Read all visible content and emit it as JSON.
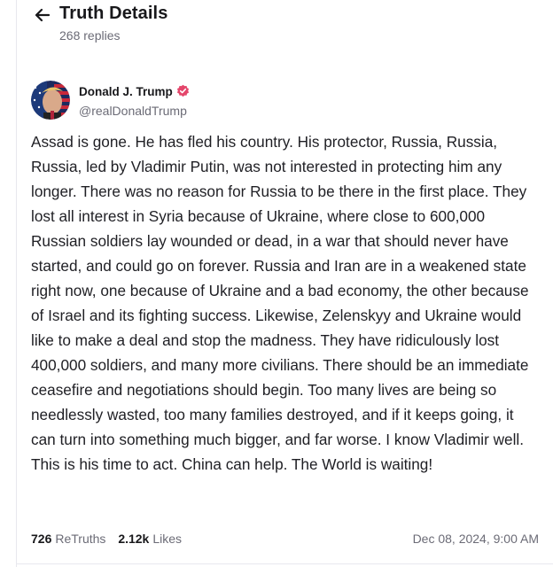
{
  "header": {
    "title": "Truth Details",
    "replies": "268 replies",
    "back_icon": "arrow-left-icon"
  },
  "post": {
    "author": {
      "name": "Donald J. Trump",
      "handle": "@realDonaldTrump",
      "verified_icon": "verified-badge-icon",
      "verified_color": "#e4466b"
    },
    "text": "Assad is gone. He has fled his country. His protector, Russia, Russia, Russia, led by Vladimir Putin, was not interested in protecting him any longer. There was no reason for Russia to be there in the first place. They lost all interest in Syria because of Ukraine, where close to 600,000 Russian soldiers lay wounded or dead, in a war that should never have started, and could go on forever. Russia and Iran are in a weakened state right now, one because of Ukraine and a bad economy, the other because of Israel and its fighting success. Likewise, Zelenskyy and Ukraine would like to make a deal and stop the madness. They have ridiculously lost 400,000 soldiers, and many more civilians. There should be an immediate ceasefire and negotiations should begin. Too many lives are being so needlessly wasted, too many families destroyed, and if it keeps going, it can turn into something much bigger, and far worse. I know Vladimir well. This is his time to act. China can help. The World is waiting!",
    "retruths_count": "726",
    "retruths_label": "ReTruths",
    "likes_count": "2.12k",
    "likes_label": "Likes",
    "timestamp": "Dec 08, 2024, 9:00 AM"
  }
}
